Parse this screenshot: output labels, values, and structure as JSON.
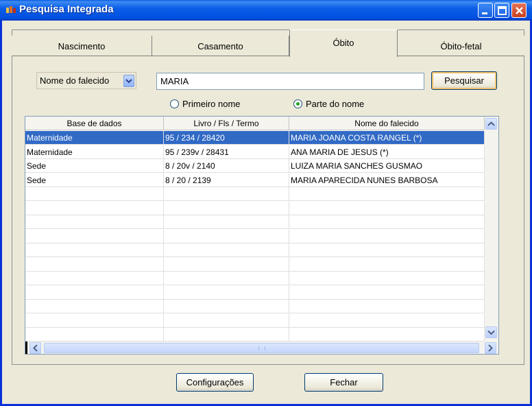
{
  "window": {
    "title": "Pesquisa Integrada"
  },
  "tabs": [
    {
      "label": "Nascimento",
      "active": false
    },
    {
      "label": "Casamento",
      "active": false
    },
    {
      "label": "Óbito",
      "active": true
    },
    {
      "label": "Óbito-fetal",
      "active": false
    }
  ],
  "search": {
    "field_selected": "Nome do falecido",
    "query": "MARIA",
    "button_label": "Pesquisar",
    "options": [
      {
        "label": "Primeiro nome",
        "checked": false
      },
      {
        "label": "Parte do nome",
        "checked": true
      }
    ]
  },
  "table": {
    "columns": [
      "Base de dados",
      "Livro / Fls / Termo",
      "Nome do falecido"
    ],
    "rows": [
      [
        "Maternidade",
        "95 / 234 / 28420",
        "MARIA JOANA COSTA RANGEL (*)"
      ],
      [
        "Maternidade",
        "95 / 239v / 28431",
        "ANA MARIA DE JESUS (*)"
      ],
      [
        "Sede",
        "8 / 20v / 2140",
        "LUIZA MARIA SANCHES GUSMAO"
      ],
      [
        "Sede",
        "8 / 20 / 2139",
        "MARIA APARECIDA NUNES BARBOSA"
      ]
    ],
    "selected_row": 0
  },
  "footer": {
    "config_label": "Configurações",
    "close_label": "Fechar"
  },
  "colors": {
    "titlebar": "#0054e3",
    "selection": "#316ac5",
    "radio_dot": "#21a121"
  }
}
